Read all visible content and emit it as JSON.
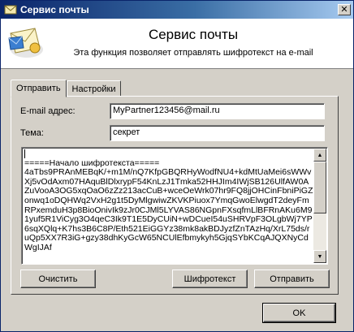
{
  "window": {
    "title": "Сервис почты",
    "close_glyph": "✕",
    "app_icon": "mail-envelope-icon"
  },
  "header": {
    "title": "Сервис почты",
    "subtitle": "Эта функция позволяет отправлять шифротекст на e-mail",
    "icon": "mail-envelope-icon"
  },
  "tabs": [
    {
      "label": "Отправить",
      "active": true
    },
    {
      "label": "Настройки",
      "active": false
    }
  ],
  "form": {
    "email_label": "E-mail адрес:",
    "email_value": "MyPartner123456@mail.ru",
    "subject_label": "Тема:",
    "subject_value": "секрет",
    "message": "\n=====Начало шифротекста=====\n4aTbs9PRAnMEBqK/+m1M/nQ7KfpGBQRHyWodfNU4+kdMtUaMei6sWWvXj5vOdAxm07HAquBlDlxrypF54KnLzJ1Tmka52HHJIm4IWjSB126UlfAW0AZuVooA3OG5xqOaO6zZz213acCuB+wceOeWrk07hr9FQ8jjOHCinFbniPiGZonwq1oDQHWq2VxH2g1t5DyMlgwiwZKVKPiuox7YmqGwoElwgdT2deyFmRPxemduH3p8BioOnivIk9zJr0CJMl5LYVAS86NGpnFXsqfmLlBFRnAKu6M91yuf5R1ViCyg3O4qeC3Ik9T1E5DyCUiN+wDCueI54uSHRVpF3OLgbWj7YP6sqXQlq+K7hs3B6C8P/Eth521EiGGYz38mk8akBDJyzfZnTAzHq/XrL75ds/ruQp5XX7R3iG+gzy38dhKyGcW65NCUlEfbmykyh5GjqSYbKCqAJQXNyCdWgIJAf"
  },
  "buttons": {
    "clear": "Очистить",
    "encrypt": "Шифротекст",
    "send": "Отправить",
    "ok": "OK"
  },
  "scrollbar": {
    "up_glyph": "▲",
    "down_glyph": "▼"
  }
}
